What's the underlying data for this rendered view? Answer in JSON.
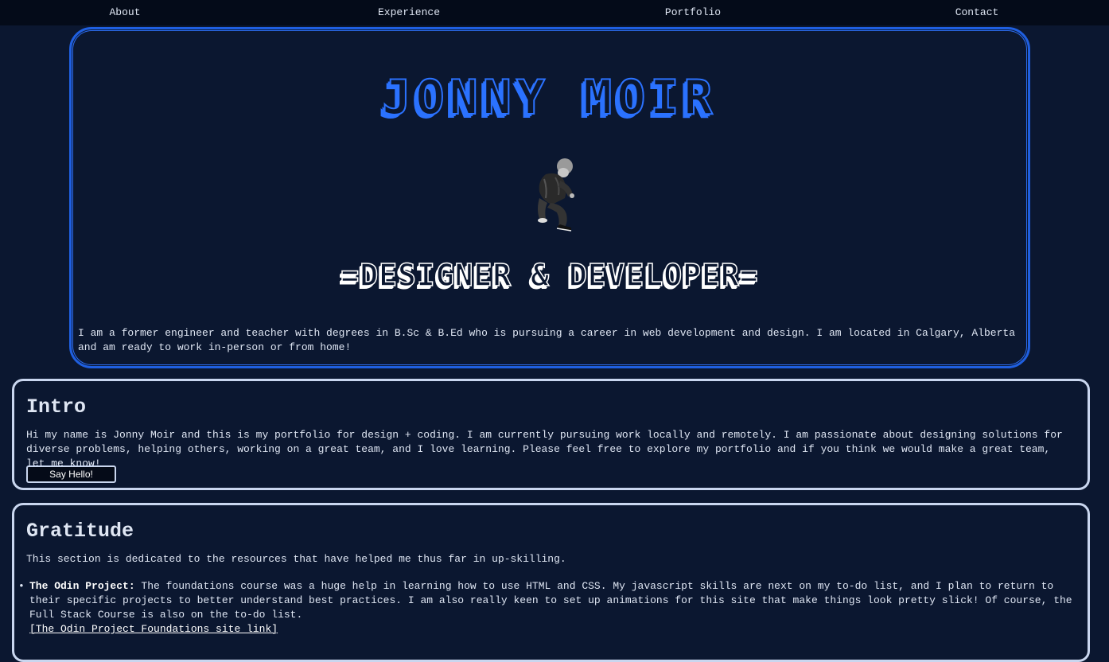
{
  "nav": {
    "items": [
      {
        "label": "About"
      },
      {
        "label": "Experience"
      },
      {
        "label": "Portfolio"
      },
      {
        "label": "Contact"
      }
    ]
  },
  "hero": {
    "name": "JONNY MOIR",
    "tagline": "=DESIGNER & DEVELOPER=",
    "bio": "I am a former engineer and teacher with degrees in B.Sc & B.Ed who is pursuing a career in web development and design. I am located in Calgary, Alberta and am ready to work in-person or from home!"
  },
  "intro": {
    "heading": "Intro",
    "text": "Hi my name is Jonny Moir and this is my portfolio for design + coding. I am currently pursuing work locally and remotely. I am passionate about designing solutions for diverse problems, helping others, working on a great team, and I love learning. Please feel free to explore my portfolio and if you think we would make a great team, let me know!",
    "button_label": "Say Hello!"
  },
  "gratitude": {
    "heading": "Gratitude",
    "text": "This section is dedicated to the resources that have helped me thus far in up-skilling.",
    "resources": [
      {
        "title": "The Odin Project:",
        "text": " The foundations course was a huge help in learning how to use HTML and CSS. My javascript skills are next on my to-do list, and I plan to return to their specific projects to better understand best practices. I am also really keen to set up animations for this site that make things look pretty slick! Of course, the Full Stack Course is also on the to-do list.",
        "link": "[The Odin Project Foundations site link]"
      }
    ]
  },
  "colors": {
    "background": "#0b1730",
    "nav_background": "#040b19",
    "accent_blue": "#2b72ff",
    "card_border": "#c9d6ef"
  }
}
